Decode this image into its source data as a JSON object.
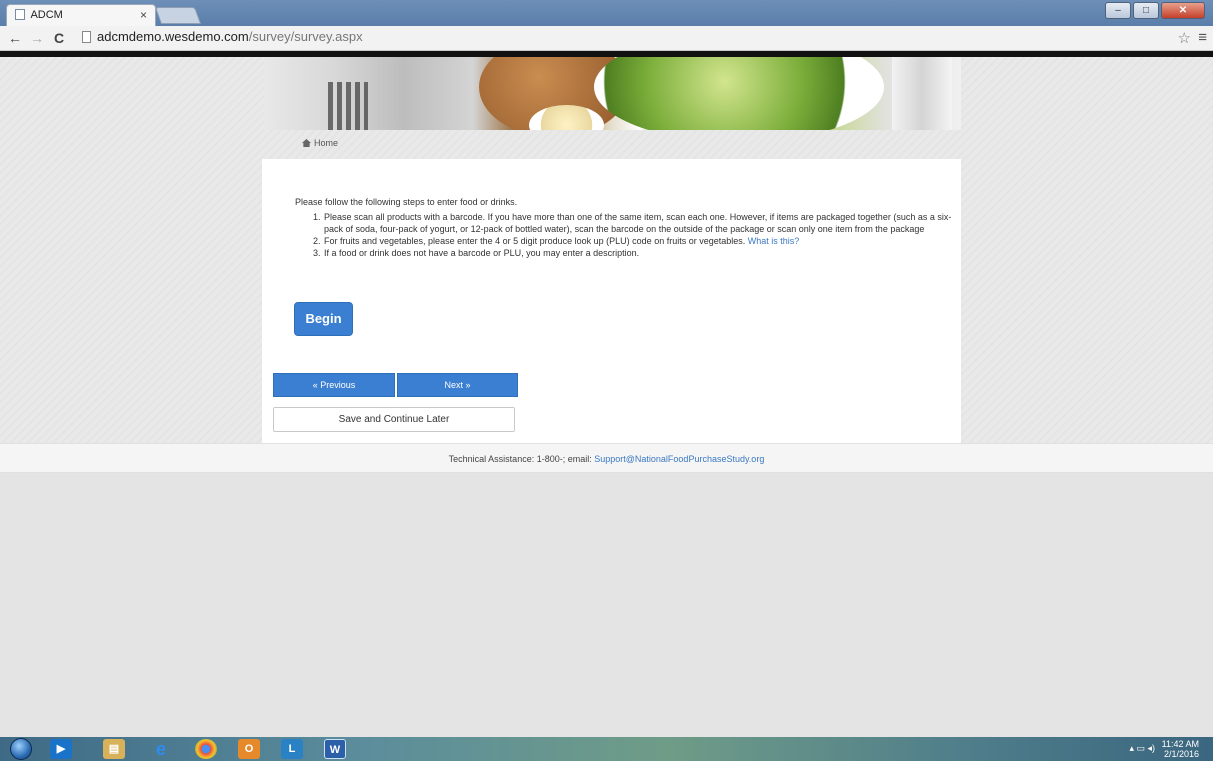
{
  "browser": {
    "tab_title": "ADCM",
    "tab_close": "×",
    "url_domain": "adcmdemo.wesdemo.com",
    "url_path": "/survey/survey.aspx"
  },
  "breadcrumb": {
    "home_label": "Home"
  },
  "survey": {
    "intro": "Please follow the following steps to enter food or drinks.",
    "steps": [
      {
        "num": "1.",
        "text": "Please scan all products with a barcode. If you have more than one of the same item, scan each one. However, if items are packaged together (such as a six-pack of soda, four-pack of yogurt, or 12-pack of bottled water), scan the barcode on the outside of the package or scan only one item from the package"
      },
      {
        "num": "2.",
        "text": "For fruits and vegetables, please enter the 4 or 5 digit produce look up (PLU) code on fruits or vegetables.",
        "link": "What is this?"
      },
      {
        "num": "3.",
        "text": "If a food or drink does not have a barcode or PLU, you may enter a description."
      }
    ],
    "begin_label": "Begin",
    "previous_label": "« Previous",
    "next_label": "Next »",
    "save_label": "Save and Continue Later"
  },
  "footer": {
    "text": "Technical Assistance: 1-800-; email:",
    "email": "Support@NationalFoodPurchaseStudy.org"
  },
  "taskbar": {
    "time": "11:42 AM",
    "date": "2/1/2016"
  },
  "colors": {
    "accent": "#3a7fd1",
    "link": "#3a79c2"
  }
}
